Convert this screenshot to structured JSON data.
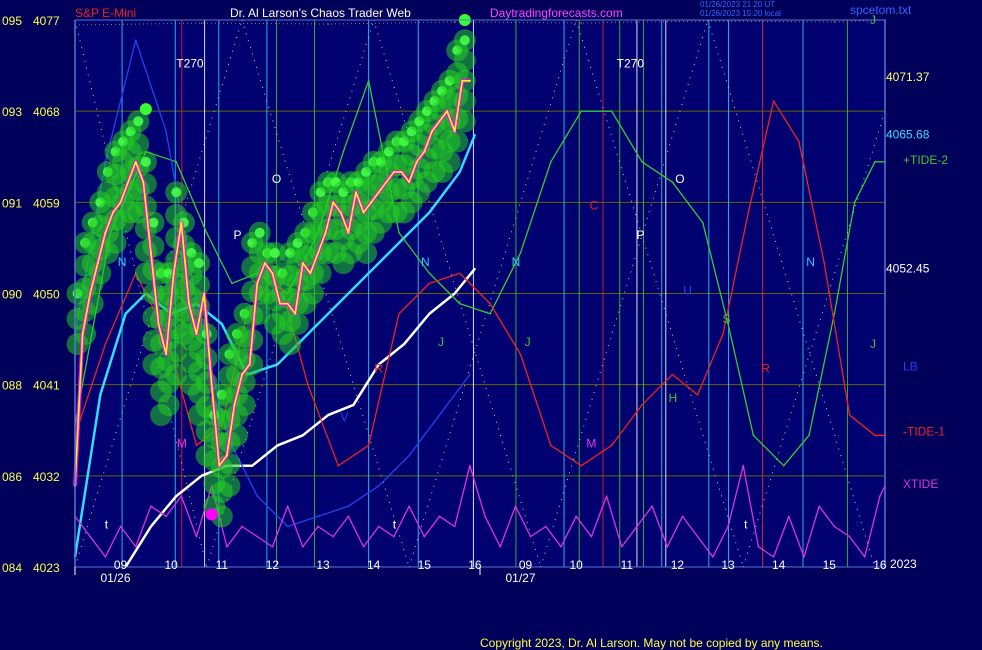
{
  "header": {
    "symbol": "S&P E-Mini",
    "title": "Dr. Al Larson's Chaos Trader Web",
    "site": "Daytradingforecasts.com",
    "stamp_line1": "01/26/2023 21:20 UT",
    "stamp_line2": "01/26/2023 15:20 local",
    "file": "spcetom.txt"
  },
  "footer": {
    "copyright": "Copyright 2023, Dr. Al Larson. May not be copied by any means.",
    "year": "2023"
  },
  "colors": {
    "background": "#00005a",
    "plot_bg": "#000070",
    "price": "#ffff00",
    "price_inner": "#ff00ff",
    "bubbles": "#22cc22",
    "ma_fast": "#33ddff",
    "ma_slow": "#ffffff",
    "tide_plus2": "#33cc33",
    "tide_minus1": "#ee2222",
    "lb": "#2244ee",
    "xtide": "#dd33dd"
  },
  "chart_data": {
    "type": "line",
    "y_axis_left": {
      "ticks": [
        {
          "label_a": "095",
          "label_b": "4077",
          "value": 4077
        },
        {
          "label_a": "093",
          "label_b": "4068",
          "value": 4068
        },
        {
          "label_a": "091",
          "label_b": "4059",
          "value": 4059
        },
        {
          "label_a": "090",
          "label_b": "4050",
          "value": 4050
        },
        {
          "label_a": "088",
          "label_b": "4041",
          "value": 4041
        },
        {
          "label_a": "086",
          "label_b": "4032",
          "value": 4032
        },
        {
          "label_a": "084",
          "label_b": "4023",
          "value": 4023
        }
      ],
      "ylim": [
        4023,
        4077
      ]
    },
    "x_axis": {
      "hour_ticks": [
        "09",
        "10",
        "11",
        "12",
        "13",
        "14",
        "15",
        "16",
        "09",
        "10",
        "11",
        "12",
        "13",
        "14",
        "15",
        "16"
      ],
      "date_labels": [
        "01/26",
        "01/27"
      ],
      "xlim": [
        0,
        16
      ]
    },
    "right_labels": [
      {
        "text": "J",
        "value": 4077,
        "color": "#33cc33"
      },
      {
        "text": "4071.37",
        "value": 4071.37,
        "color": "#ffff66"
      },
      {
        "text": "4065.68",
        "value": 4065.68,
        "color": "#33ddff"
      },
      {
        "text": "+TIDE-2",
        "value": 4063.2,
        "color": "#33cc33"
      },
      {
        "text": "4052.45",
        "value": 4052.45,
        "color": "#ffffff"
      },
      {
        "text": "J",
        "value": 4045.0,
        "color": "#33cc33"
      },
      {
        "text": "LB",
        "value": 4042.8,
        "color": "#2244ee"
      },
      {
        "text": "-TIDE-1",
        "value": 4036.4,
        "color": "#ee2222"
      },
      {
        "text": "XTIDE",
        "value": 4031.2,
        "color": "#dd33dd"
      }
    ],
    "vertical_markers": [
      {
        "x": 0.93,
        "color": "#33ccff"
      },
      {
        "x": 1.98,
        "color": "#33ccff"
      },
      {
        "x": 2.11,
        "color": "#ee2233"
      },
      {
        "x": 2.56,
        "color": "#ffffff"
      },
      {
        "x": 2.84,
        "color": "#33ccff"
      },
      {
        "x": 3.79,
        "color": "#33ccff"
      },
      {
        "x": 3.98,
        "color": "#33cc33"
      },
      {
        "x": 4.73,
        "color": "#33cc33"
      },
      {
        "x": 5.8,
        "color": "#33ccff"
      },
      {
        "x": 6.78,
        "color": "#33ccff"
      },
      {
        "x": 7.87,
        "color": "#ffffff"
      },
      {
        "x": 8.71,
        "color": "#33cc33"
      },
      {
        "x": 9.66,
        "color": "#33ccff"
      },
      {
        "x": 9.96,
        "color": "#33cc33"
      },
      {
        "x": 10.43,
        "color": "#ee2233"
      },
      {
        "x": 10.76,
        "color": "#33cc33"
      },
      {
        "x": 11.1,
        "color": "#ffffff"
      },
      {
        "x": 11.23,
        "color": "#33cc33"
      },
      {
        "x": 11.59,
        "color": "#33ccff"
      },
      {
        "x": 11.67,
        "color": "#ffffff"
      },
      {
        "x": 12.52,
        "color": "#33ccff"
      },
      {
        "x": 12.91,
        "color": "#33ccff"
      },
      {
        "x": 13.58,
        "color": "#ee2233"
      },
      {
        "x": 14.38,
        "color": "#33ccff"
      },
      {
        "x": 15.26,
        "color": "#33cc33"
      }
    ],
    "annotations": [
      {
        "text": "T270",
        "x": 2.27,
        "y": 4072.3,
        "color": "#ffffff"
      },
      {
        "text": "T270",
        "x": 10.97,
        "y": 4072.3,
        "color": "#ffffff"
      },
      {
        "text": "O",
        "x": 3.98,
        "y": 4060.9,
        "color": "#ffffff"
      },
      {
        "text": "O",
        "x": 11.95,
        "y": 4060.9,
        "color": "#ffffff"
      },
      {
        "text": "P",
        "x": 3.21,
        "y": 4055.4,
        "color": "#ffffff"
      },
      {
        "text": "P",
        "x": 11.17,
        "y": 4055.4,
        "color": "#ffffff"
      },
      {
        "text": "C",
        "x": 10.25,
        "y": 4058.3,
        "color": "#ee2222"
      },
      {
        "text": "N",
        "x": 0.93,
        "y": 4052.7,
        "color": "#33ccff"
      },
      {
        "text": "N",
        "x": 6.92,
        "y": 4052.7,
        "color": "#33ccff"
      },
      {
        "text": "N",
        "x": 8.71,
        "y": 4052.7,
        "color": "#33ccff"
      },
      {
        "text": "N",
        "x": 14.53,
        "y": 4052.7,
        "color": "#33ccff"
      },
      {
        "text": "U",
        "x": 12.1,
        "y": 4049.9,
        "color": "#2244ee"
      },
      {
        "text": "S",
        "x": 12.87,
        "y": 4047.1,
        "color": "#33cc33"
      },
      {
        "text": "M",
        "x": 2.11,
        "y": 4034.8,
        "color": "#ee33ee"
      },
      {
        "text": "M",
        "x": 10.2,
        "y": 4034.8,
        "color": "#ee33ee"
      },
      {
        "text": "R",
        "x": 6.0,
        "y": 4042.2,
        "color": "#ee2222"
      },
      {
        "text": "R",
        "x": 13.64,
        "y": 4042.2,
        "color": "#ee2222"
      },
      {
        "text": "H",
        "x": 11.81,
        "y": 4039.3,
        "color": "#33cc33"
      },
      {
        "text": "J",
        "x": 8.94,
        "y": 4044.8,
        "color": "#33cc33"
      },
      {
        "text": "J",
        "x": 7.23,
        "y": 4044.8,
        "color": "#33cc33"
      },
      {
        "text": "V",
        "x": 5.32,
        "y": 4037.4,
        "color": "#2244ee"
      },
      {
        "text": "t",
        "x": 0.62,
        "y": 4026.8,
        "color": "#ffffff"
      },
      {
        "text": "t",
        "x": 6.31,
        "y": 4026.8,
        "color": "#ffffff"
      },
      {
        "text": "t",
        "x": 13.25,
        "y": 4026.8,
        "color": "#ffffff"
      }
    ],
    "series": [
      {
        "name": "price",
        "x": [
          0.0,
          0.15,
          0.3,
          0.45,
          0.6,
          0.75,
          0.9,
          1.05,
          1.2,
          1.35,
          1.5,
          1.65,
          1.8,
          1.95,
          2.1,
          2.25,
          2.4,
          2.55,
          2.7,
          2.85,
          3.0,
          3.15,
          3.3,
          3.45,
          3.6,
          3.75,
          3.9,
          4.05,
          4.2,
          4.35,
          4.5,
          4.65,
          4.8,
          4.95,
          5.1,
          5.25,
          5.4,
          5.55,
          5.7,
          5.85,
          6.0,
          6.15,
          6.3,
          6.45,
          6.6,
          6.75,
          6.9,
          7.05,
          7.2,
          7.35,
          7.5,
          7.65,
          7.8
        ],
        "values": [
          4031,
          4046,
          4050,
          4053,
          4056,
          4058,
          4059,
          4061,
          4063,
          4061,
          4054,
          4047,
          4044,
          4052,
          4057,
          4049,
          4046,
          4050,
          4041,
          4033,
          4034,
          4039,
          4042,
          4043,
          4051,
          4053,
          4052,
          4049,
          4049,
          4048,
          4053,
          4052,
          4054,
          4056,
          4059,
          4058,
          4056,
          4060,
          4058,
          4059,
          4060,
          4061,
          4062,
          4062,
          4061,
          4063,
          4064,
          4066,
          4067,
          4068,
          4066,
          4071,
          4071
        ]
      },
      {
        "name": "",
        "x": [
          0.0,
          0.5,
          1.0,
          1.4,
          1.9,
          2.4,
          2.9,
          3.4,
          4.0,
          4.6,
          5.2,
          5.8,
          6.4,
          7.0,
          7.6,
          7.9
        ],
        "values": [
          4024,
          4040,
          4048,
          4050,
          4048,
          4049,
          4047,
          4042,
          4043,
          4046,
          4049,
          4052,
          4055,
          4058,
          4062,
          4065.68
        ]
      },
      {
        "name": "",
        "x": [
          1.0,
          1.5,
          2.0,
          2.5,
          3.0,
          3.5,
          4.0,
          4.5,
          5.0,
          5.5,
          6.0,
          6.5,
          7.0,
          7.5,
          7.9
        ],
        "values": [
          4023,
          4027,
          4030,
          4032,
          4033,
          4033,
          4035,
          4036,
          4038,
          4039,
          4043,
          4045,
          4048,
          4050,
          4052.45
        ]
      },
      {
        "name": "+TIDE-2",
        "x": [
          0.0,
          0.7,
          1.4,
          2.0,
          2.6,
          3.1,
          3.6,
          4.2,
          4.8,
          5.3,
          5.8,
          6.4,
          7.0,
          7.6,
          8.2,
          8.8,
          9.4,
          10.0,
          10.6,
          11.2,
          11.8,
          12.4,
          12.9,
          13.4,
          14.0,
          14.5,
          15.0,
          15.4,
          15.8,
          16.0
        ],
        "values": [
          4037,
          4056,
          4064,
          4063,
          4056,
          4051,
          4052,
          4050,
          4056,
          4064,
          4071,
          4056,
          4052,
          4049,
          4048,
          4054,
          4063,
          4068,
          4068,
          4063,
          4061,
          4057,
          4047,
          4036,
          4033,
          4036,
          4048,
          4059,
          4063,
          4063
        ]
      },
      {
        "name": "-TIDE-1",
        "x": [
          0.0,
          0.6,
          1.2,
          1.8,
          2.4,
          2.9,
          3.4,
          4.0,
          4.6,
          5.2,
          5.8,
          6.4,
          7.0,
          7.6,
          8.2,
          8.8,
          9.4,
          10.0,
          10.6,
          11.2,
          11.8,
          12.3,
          12.8,
          13.3,
          13.8,
          14.3,
          14.8,
          15.3,
          15.8,
          16.0
        ],
        "values": [
          4036,
          4045,
          4052,
          4046,
          4035,
          4037,
          4048,
          4052,
          4041,
          4033,
          4035,
          4048,
          4051,
          4052,
          4049,
          4044,
          4035,
          4033,
          4035,
          4039,
          4042,
          4040,
          4046,
          4058,
          4069,
          4065,
          4053,
          4038,
          4036,
          4036
        ]
      },
      {
        "name": "LB",
        "x": [
          0.0,
          0.6,
          1.2,
          1.8,
          2.4,
          3.0,
          3.6,
          4.2,
          4.8,
          5.4,
          6.0,
          6.6,
          7.2,
          7.8
        ],
        "values": [
          4046,
          4063,
          4075,
          4066,
          4049,
          4036,
          4030,
          4027,
          4028,
          4029,
          4031,
          4034,
          4038,
          4042
        ]
      },
      {
        "name": "XTIDE",
        "x": [
          0.0,
          0.3,
          0.6,
          0.9,
          1.2,
          1.5,
          1.8,
          2.1,
          2.4,
          2.7,
          3.0,
          3.3,
          3.6,
          3.9,
          4.2,
          4.5,
          4.8,
          5.1,
          5.4,
          5.7,
          6.0,
          6.3,
          6.6,
          6.9,
          7.2,
          7.5,
          7.8,
          8.1,
          8.4,
          8.7,
          9.0,
          9.3,
          9.6,
          9.9,
          10.2,
          10.5,
          10.8,
          11.1,
          11.4,
          11.7,
          12.0,
          12.3,
          12.6,
          12.9,
          13.2,
          13.5,
          13.8,
          14.1,
          14.4,
          14.7,
          15.0,
          15.3,
          15.6,
          15.9,
          16.0
        ],
        "values": [
          4028,
          4026,
          4024,
          4027,
          4025,
          4029,
          4028,
          4030,
          4026,
          4031,
          4025,
          4027,
          4026,
          4025,
          4029,
          4025,
          4027,
          4026,
          4028,
          4025,
          4027,
          4026,
          4029,
          4026,
          4028,
          4027,
          4033,
          4028,
          4025,
          4029,
          4026,
          4027,
          4025,
          4028,
          4026,
          4030,
          4025,
          4027,
          4029,
          4025,
          4028,
          4026,
          4024,
          4027,
          4033,
          4025,
          4024,
          4028,
          4024,
          4029,
          4027,
          4026,
          4024,
          4030,
          4031
        ]
      },
      {
        "name": "",
        "x": [
          0.0,
          2.5,
          5.0,
          7.5,
          10.0,
          12.5,
          15.0,
          16.0
        ],
        "values": [
          4076.5,
          4076.7,
          4076.6,
          4076.8,
          4076.7,
          4076.9,
          4076.8,
          4077
        ]
      }
    ],
    "bubble_points": {
      "x": [
        0.05,
        0.2,
        0.35,
        0.5,
        0.65,
        0.8,
        0.95,
        1.1,
        1.25,
        1.4,
        1.55,
        1.7,
        1.85,
        2.0,
        2.15,
        2.3,
        2.45,
        2.6,
        2.75,
        2.9,
        3.05,
        3.2,
        3.35,
        3.5,
        3.65,
        3.8,
        3.95,
        4.1,
        4.25,
        4.4,
        4.55,
        4.7,
        4.85,
        5.0,
        5.15,
        5.3,
        5.45,
        5.6,
        5.75,
        5.9,
        6.05,
        6.2,
        6.35,
        6.5,
        6.65,
        6.8,
        6.95,
        7.1,
        7.25,
        7.4,
        7.55,
        7.7
      ],
      "high": [
        4050,
        4055,
        4057,
        4059,
        4062,
        4064,
        4065,
        4066,
        4067,
        4063,
        4057,
        4052,
        4052,
        4060,
        4057,
        4054,
        4053,
        4046,
        4038,
        4040,
        4044,
        4046,
        4048,
        4055,
        4056,
        4054,
        4054,
        4052,
        4054,
        4055,
        4056,
        4058,
        4060,
        4061,
        4061,
        4060,
        4061,
        4061,
        4062,
        4063,
        4063,
        4064,
        4065,
        4065,
        4066,
        4067,
        4068,
        4069,
        4070,
        4071,
        4074,
        4075
      ],
      "low": [
        4045,
        4046,
        4049,
        4052,
        4054,
        4055,
        4057,
        4058,
        4058,
        4052,
        4043,
        4038,
        4039,
        4042,
        4046,
        4041,
        4038,
        4034,
        4029,
        4028,
        4031,
        4036,
        4039,
        4043,
        4048,
        4050,
        4047,
        4046,
        4045,
        4047,
        4049,
        4050,
        4052,
        4054,
        4054,
        4053,
        4054,
        4055,
        4054,
        4056,
        4057,
        4058,
        4058,
        4058,
        4059,
        4060,
        4061,
        4062,
        4062,
        4063,
        4065,
        4067
      ]
    },
    "markers": [
      {
        "x": 2.7,
        "y": 4028.2,
        "color": "#ff00ff"
      },
      {
        "x": 1.4,
        "y": 4068.2,
        "color": "#33ff33"
      },
      {
        "x": 7.7,
        "y": 4077,
        "color": "#33ff33"
      }
    ]
  }
}
